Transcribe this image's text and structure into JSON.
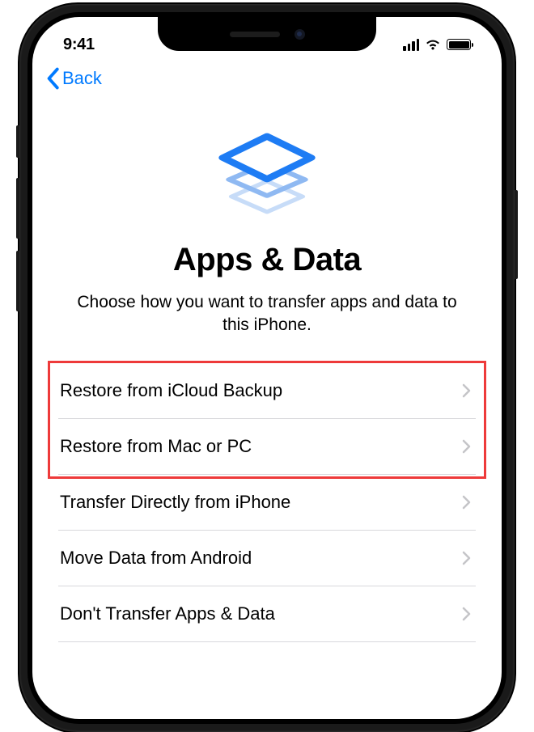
{
  "status": {
    "time": "9:41"
  },
  "nav": {
    "back_label": "Back"
  },
  "page": {
    "title": "Apps & Data",
    "subtitle": "Choose how you want to transfer apps and data to this iPhone."
  },
  "options": [
    {
      "label": "Restore from iCloud Backup"
    },
    {
      "label": "Restore from Mac or PC"
    },
    {
      "label": "Transfer Directly from iPhone"
    },
    {
      "label": "Move Data from Android"
    },
    {
      "label": "Don't Transfer Apps & Data"
    }
  ],
  "colors": {
    "accent": "#007aff",
    "highlight": "#ee3a3a"
  }
}
